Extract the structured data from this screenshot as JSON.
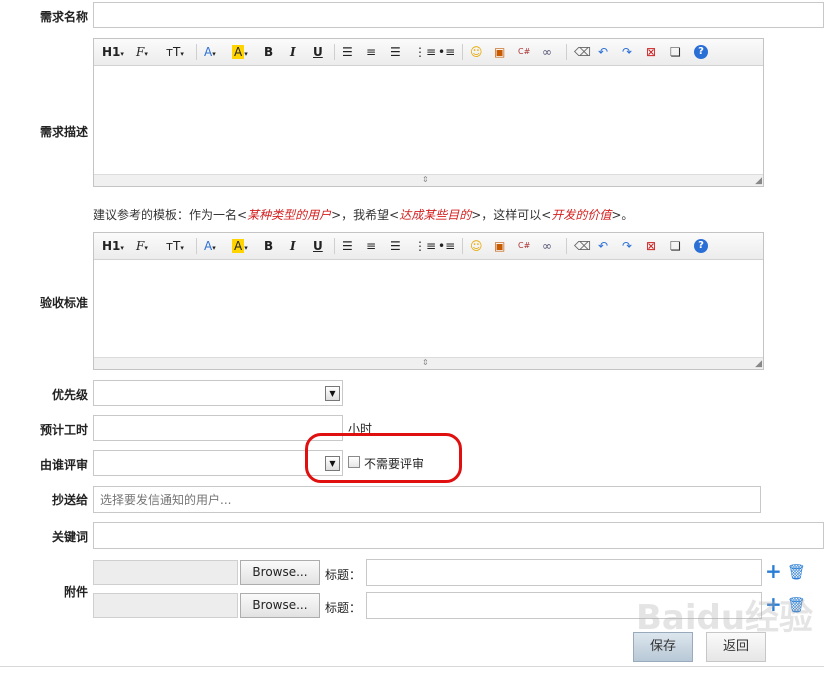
{
  "form": {
    "name_label": "需求名称",
    "desc_label": "需求描述",
    "template_prefix": "建议参考的模板：作为一名<",
    "template_user": "某种类型的用户",
    "template_mid1": ">，我希望<",
    "template_goal": "达成某些目的",
    "template_mid2": ">，这样可以<",
    "template_value": "开发的价值",
    "template_suffix": ">。",
    "acceptance_label": "验收标准",
    "priority_label": "优先级",
    "estimate_label": "预计工时",
    "estimate_unit": "小时",
    "reviewer_label": "由谁评审",
    "no_review_label": "不需要评审",
    "mailto_label": "抄送给",
    "mailto_placeholder": "选择要发信通知的用户...",
    "keywords_label": "关键词",
    "attachment_label": "附件",
    "browse_label": "Browse...",
    "title_label": "标题：",
    "save_label": "保存",
    "back_label": "返回"
  },
  "toolbar": {
    "h1": "H1",
    "font": "F",
    "size": "тT",
    "fontcolor": "A",
    "highlight": "A",
    "bold": "B",
    "italic": "I",
    "underline": "U",
    "code": "C#"
  },
  "watermark": {
    "text": "Baidu经验"
  },
  "colors": {
    "template_red": "#d41f1f",
    "highlight_circle": "#e01010",
    "icon_blue": "#2a7dd4"
  }
}
